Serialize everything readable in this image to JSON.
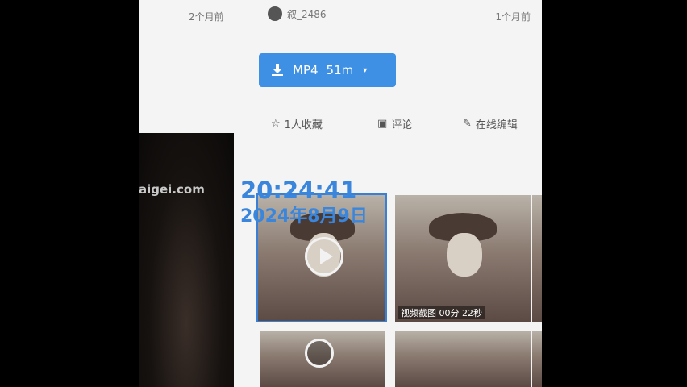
{
  "meta": {
    "time_left": "2个月前",
    "username": "叙_2486",
    "time_right": "1个月前"
  },
  "download": {
    "format": "MP4",
    "size": "51m",
    "caret": "▾",
    "color": "#3d90e3"
  },
  "actions": {
    "favorite": "1人收藏",
    "comment": "评论",
    "edit": "在线编辑"
  },
  "watermark": "aigei.com",
  "thumbnail": {
    "duration": "视频截图 00分 22秒"
  },
  "timestamp": {
    "time": "20:24:41",
    "date": "2024年8月9日",
    "color": "#3a86dc"
  }
}
